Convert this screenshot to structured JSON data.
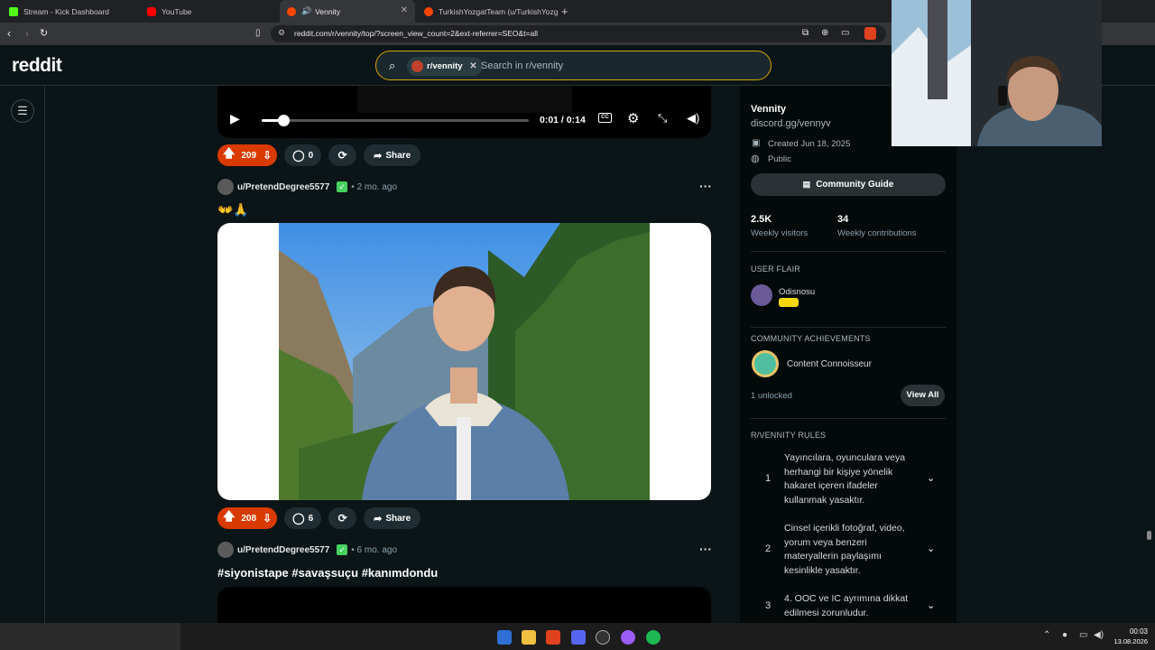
{
  "browser": {
    "tabs": [
      {
        "title": "Stream - Kick Dashboard",
        "icon": "kick-icon",
        "color": "#53fc18",
        "active": false
      },
      {
        "title": "YouTube",
        "icon": "youtube-icon",
        "color": "#ff0000",
        "active": false
      },
      {
        "title": "Vennity",
        "icon": "reddit-icon",
        "color": "#ff4500",
        "active": true
      },
      {
        "title": "TurkishYozgatTeam (u/TurkishYozgat",
        "icon": "reddit-icon",
        "color": "#ff4500",
        "active": false
      }
    ],
    "url": "reddit.com/r/vennity/top/?screen_view_count=2&ext-referrer=SEO&t=all"
  },
  "header": {
    "logo": "reddit",
    "search_chip": "r/vennity",
    "search_placeholder": "Search in r/vennity"
  },
  "player": {
    "time": "0:01 / 0:14",
    "progress": 0.08
  },
  "posts": [
    {
      "votes": "209",
      "comments": "0",
      "share": "Share"
    },
    {
      "author": "u/PretendDegree5577",
      "age": "• 2 mo. ago",
      "title": "👐🙏",
      "votes": "208",
      "comments": "6",
      "share": "Share"
    },
    {
      "author": "u/PretendDegree5577",
      "age": "• 6 mo. ago",
      "title": "#siyonistape #savaşsuçu #kanımdondu"
    }
  ],
  "sidebar": {
    "name": "Vennity",
    "link": "discord.gg/vennyv",
    "created": "Created Jun 18, 2025",
    "visibility": "Public",
    "guide_button": "Community Guide",
    "stats": [
      {
        "value": "2.5K",
        "label": "Weekly visitors"
      },
      {
        "value": "34",
        "label": "Weekly contributions"
      }
    ],
    "user_flair_heading": "USER FLAIR",
    "flair_user": "Odisnosu",
    "achievements_heading": "COMMUNITY ACHIEVEMENTS",
    "achievement": "Content Connoisseur",
    "unlocked": "1 unlocked",
    "view_all": "View All",
    "rules_heading": "R/VENNITY RULES",
    "rules": [
      {
        "num": "1",
        "text": "Yayıncılara, oyunculara veya herhangi bir kişiye yönelik hakaret içeren ifadeler kullanmak yasaktır."
      },
      {
        "num": "2",
        "text": "Cinsel içerikli fotoğraf, video, yorum veya benzeri materyallerin paylaşımı kesinlikle yasaktır."
      },
      {
        "num": "3",
        "text": "4. OOC ve IC ayrımına dikkat edilmesi zorunludur."
      }
    ]
  },
  "taskbar": {
    "time": "00:03",
    "date": "13.08.2026"
  }
}
